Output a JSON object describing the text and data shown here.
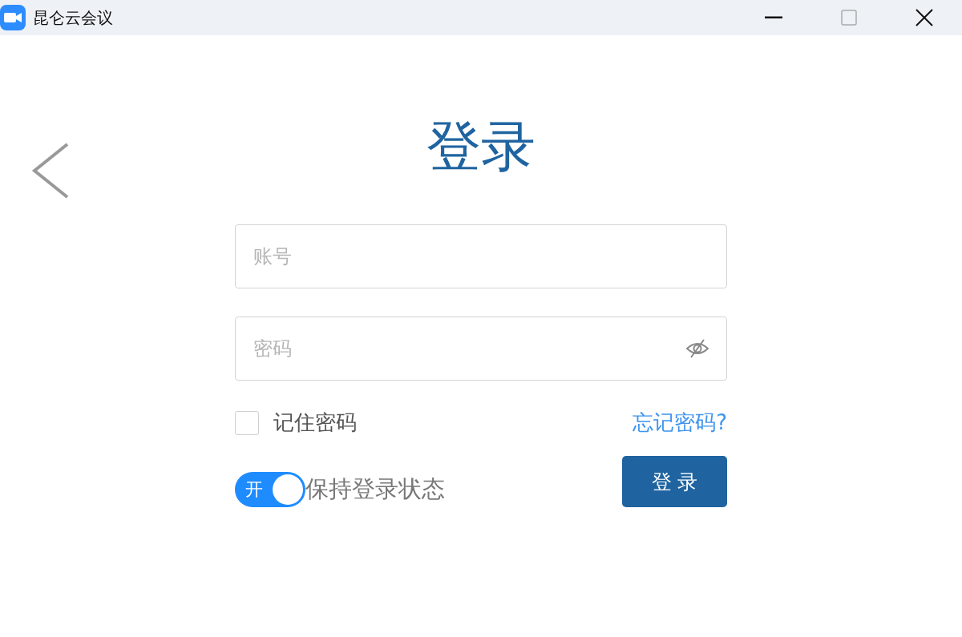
{
  "window": {
    "title": "昆仑云会议"
  },
  "heading": "登录",
  "account": {
    "placeholder": "账号"
  },
  "password": {
    "placeholder": "密码"
  },
  "remember": {
    "label": "记住密码",
    "checked": false
  },
  "forgot_link": "忘记密码?",
  "keep_login": {
    "toggle_text": "开",
    "on": true,
    "label": "保持登录状态"
  },
  "login_button": "登 录"
}
